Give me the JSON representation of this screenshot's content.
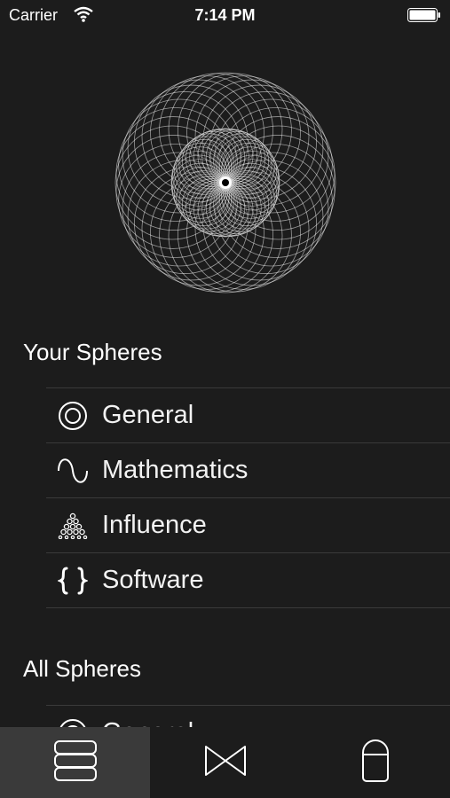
{
  "status_bar": {
    "carrier": "Carrier",
    "time": "7:14 PM"
  },
  "hero": {
    "icon": "sphere-logo-icon"
  },
  "your_spheres": {
    "title": "Your Spheres",
    "items": [
      {
        "label": "General",
        "icon": "target-icon"
      },
      {
        "label": "Mathematics",
        "icon": "sine-wave-icon"
      },
      {
        "label": "Influence",
        "icon": "triangle-dots-icon"
      },
      {
        "label": "Software",
        "icon": "curly-braces-icon"
      }
    ]
  },
  "all_spheres": {
    "title": "All Spheres",
    "items": [
      {
        "label": "General",
        "icon": "target-icon"
      }
    ]
  },
  "tabbar": {
    "tabs": [
      {
        "icon": "stack-icon",
        "active": true
      },
      {
        "icon": "bowtie-icon",
        "active": false
      },
      {
        "icon": "capsule-icon",
        "active": false
      }
    ]
  },
  "colors": {
    "background": "#1c1c1c",
    "tab_active": "#3a3a3a",
    "divider": "#3a3a3a",
    "text": "#ffffff"
  }
}
